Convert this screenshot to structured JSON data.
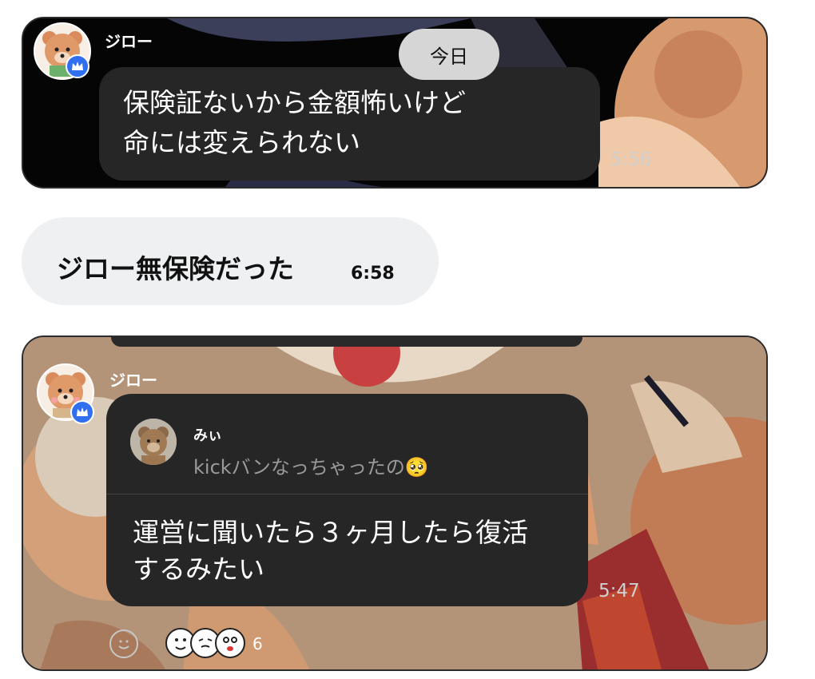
{
  "date_label": "今日",
  "messages": [
    {
      "sender": "ジロー",
      "text_lines": [
        "保険証ないから金額怖いけど",
        "命には変えられない"
      ],
      "time": "5:56"
    },
    {
      "text": "ジロー無保険だった",
      "time": "6:58"
    },
    {
      "sender": "ジロー",
      "quote": {
        "sender": "みぃ",
        "text": "kickバンなっちゃったの",
        "emoji": "🥺"
      },
      "text_lines": [
        "運営に聞いたら３ヶ月したら復活",
        "するみたい"
      ],
      "time": "5:47",
      "reaction_count": "6"
    }
  ],
  "icons": [
    "bear-avatar-icon",
    "crown-icon",
    "plush-bear-avatar-icon",
    "add-reaction-icon",
    "reaction-face-icon"
  ],
  "colors": {
    "bubble": "#262626",
    "badge": "#2f6ff0",
    "self_bubble": "#eef0f2",
    "pill": "#d6d6d6"
  }
}
